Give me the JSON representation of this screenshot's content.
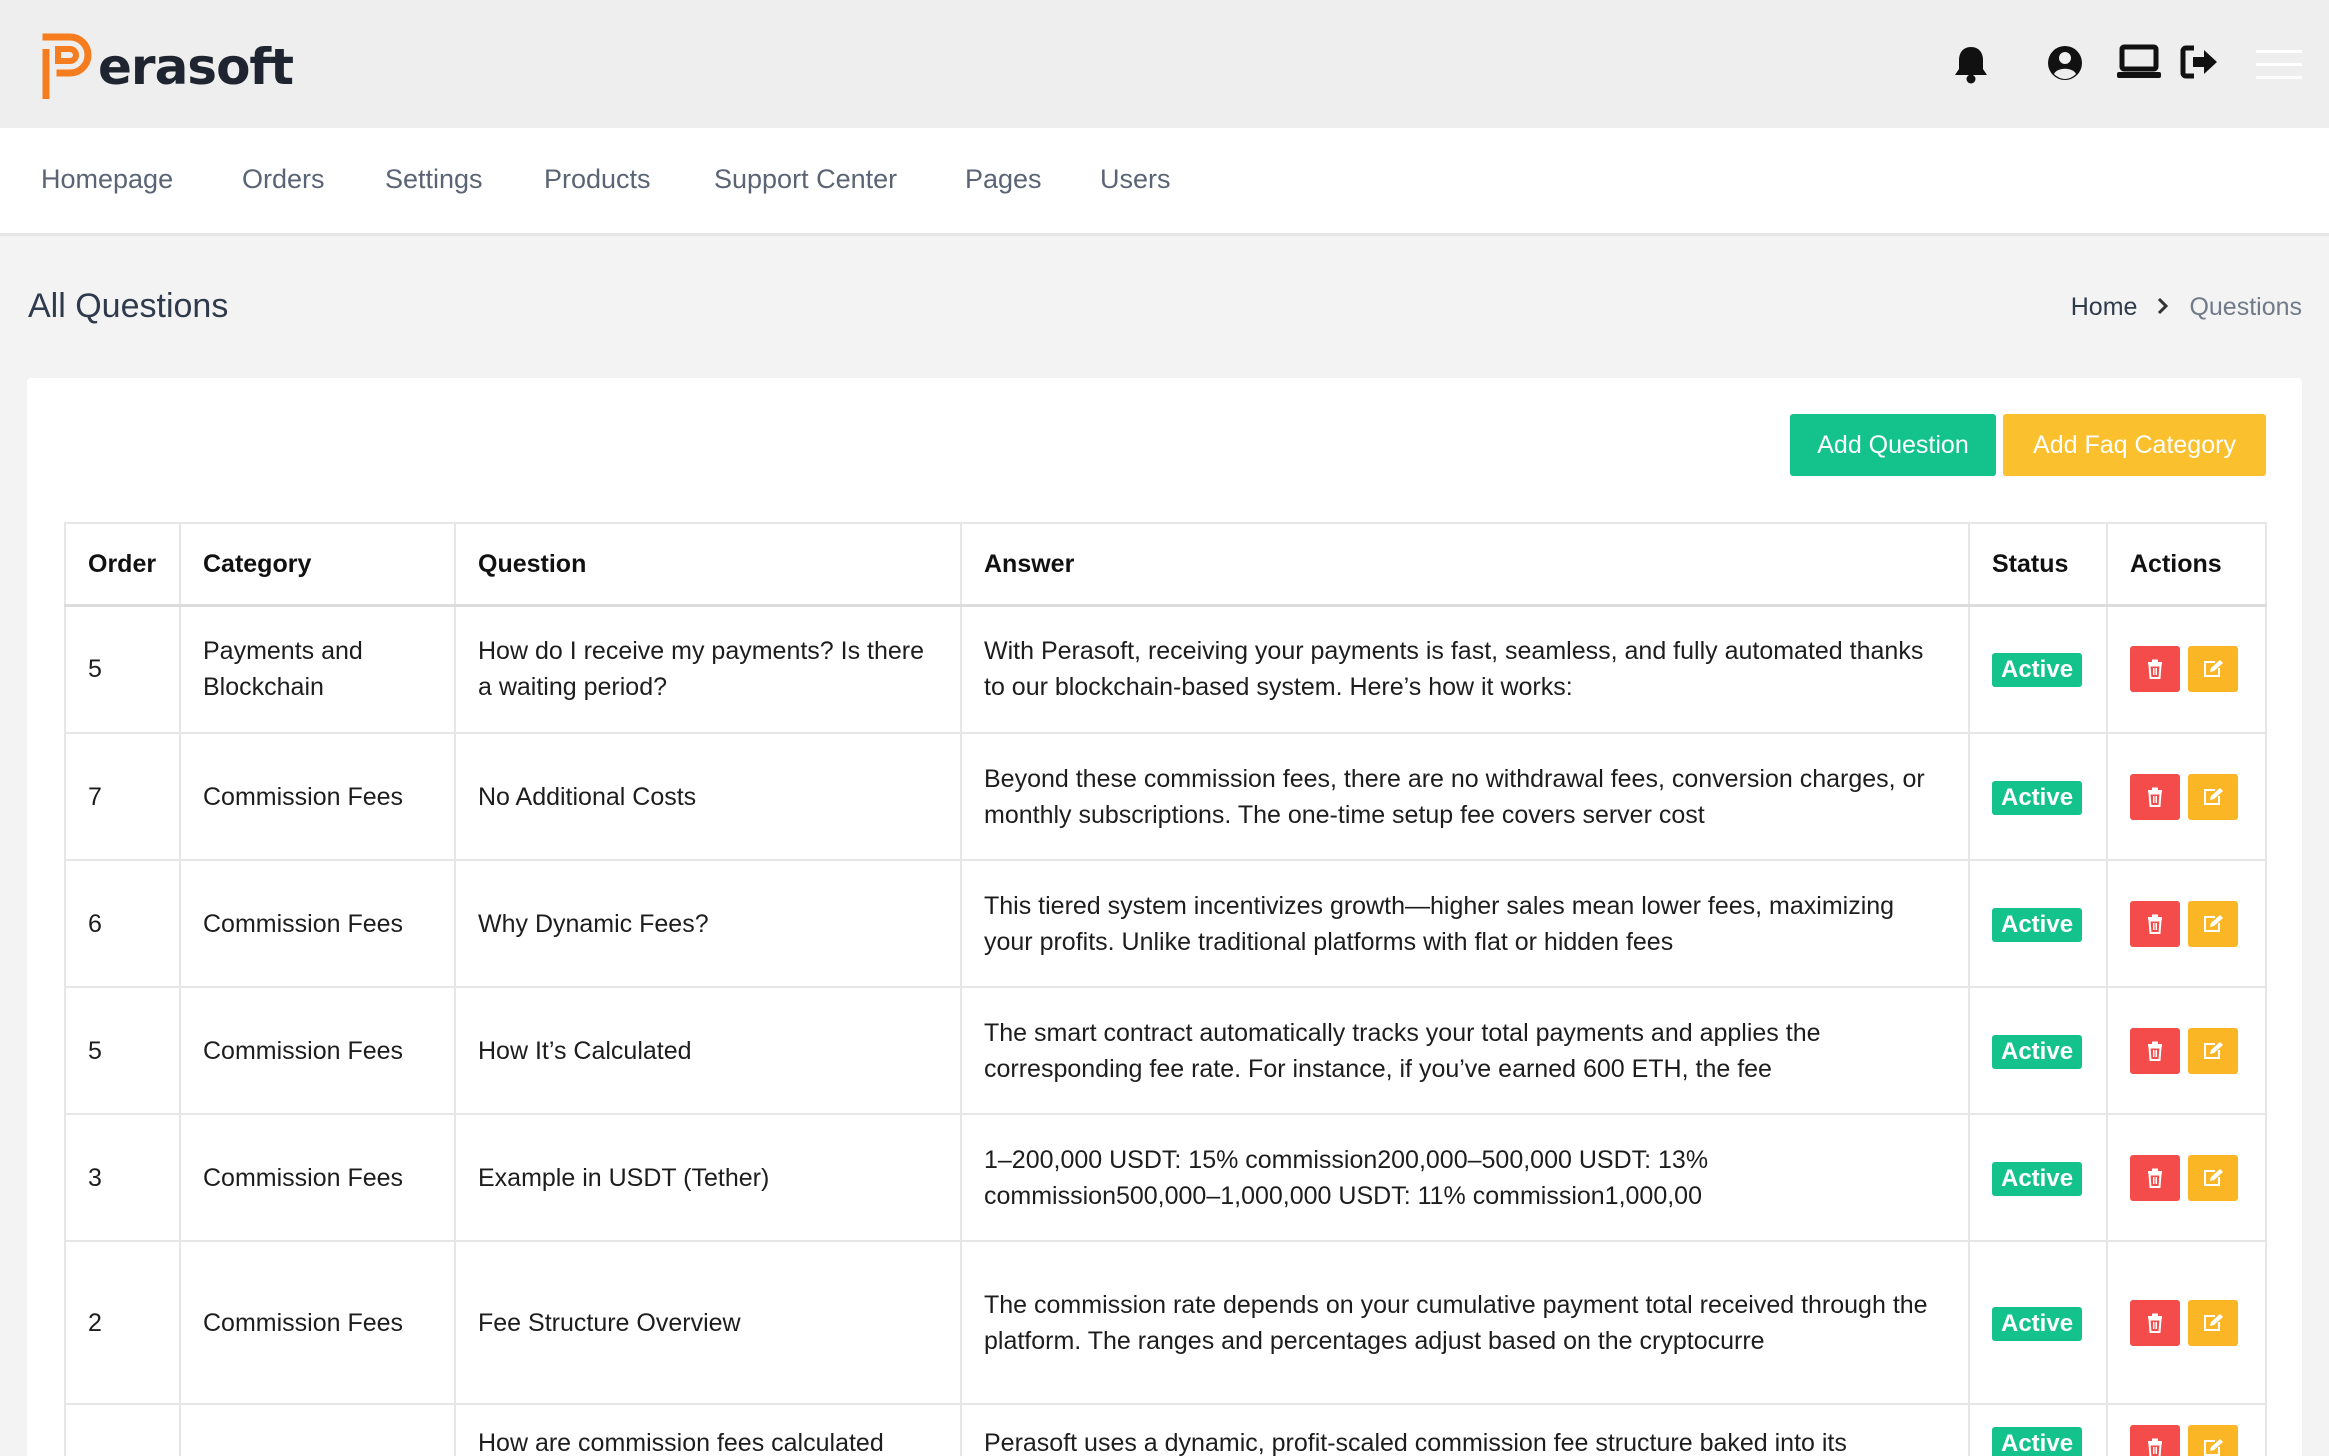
{
  "brand": {
    "name": "erasoft",
    "accent": "#f57c1f"
  },
  "topbar": {
    "icons": [
      "bell-icon",
      "user-circle-icon",
      "laptop-icon",
      "logout-icon",
      "menu-icon"
    ]
  },
  "nav": {
    "items": [
      "Homepage",
      "Orders",
      "Settings",
      "Products",
      "Support Center",
      "Pages",
      "Users"
    ]
  },
  "page": {
    "title": "All Questions",
    "breadcrumb": {
      "home": "Home",
      "current": "Questions"
    }
  },
  "toolbar": {
    "add_question": "Add Question",
    "add_faq_category": "Add Faq Category"
  },
  "table": {
    "headers": {
      "order": "Order",
      "category": "Category",
      "question": "Question",
      "answer": "Answer",
      "status": "Status",
      "actions": "Actions"
    },
    "rows": [
      {
        "order": "5",
        "category": "Payments and Blockchain",
        "question": "How do I receive my payments? Is there a waiting period?",
        "answer": "With Perasoft, receiving your payments is fast, seamless, and fully automated thanks to our blockchain-based system. Here’s how it works:",
        "status": "Active"
      },
      {
        "order": "7",
        "category": "Commission Fees",
        "question": "No Additional Costs",
        "answer": "Beyond these commission fees, there are no withdrawal fees, conversion charges, or monthly subscriptions. The one-time setup fee covers server cost",
        "status": "Active"
      },
      {
        "order": "6",
        "category": "Commission Fees",
        "question": "Why Dynamic Fees?",
        "answer": "This tiered system incentivizes growth—higher sales mean lower fees, maximizing your profits. Unlike traditional platforms with flat or hidden fees",
        "status": "Active"
      },
      {
        "order": "5",
        "category": "Commission Fees",
        "question": "How It’s Calculated",
        "answer": "The smart contract automatically tracks your total payments and applies the corresponding fee rate. For instance, if you’ve earned 600 ETH, the fee",
        "status": "Active"
      },
      {
        "order": "3",
        "category": "Commission Fees",
        "question": "Example in USDT (Tether)",
        "answer": "1–200,000 USDT: 15% commission200,000–500,000 USDT: 13% commission500,000–1,000,000 USDT: 11% commission1,000,00",
        "status": "Active"
      },
      {
        "order": "2",
        "category": "Commission Fees",
        "question": "Fee Structure Overview",
        "answer": "The commission rate depends on your cumulative payment total received through the platform. The ranges and percentages adjust based on the cryptocurre",
        "status": "Active"
      },
      {
        "order": "",
        "category": "",
        "question": "How are commission fees calculated",
        "answer": "Perasoft uses a dynamic, profit-scaled commission fee structure baked into its",
        "status": "Active"
      }
    ]
  }
}
